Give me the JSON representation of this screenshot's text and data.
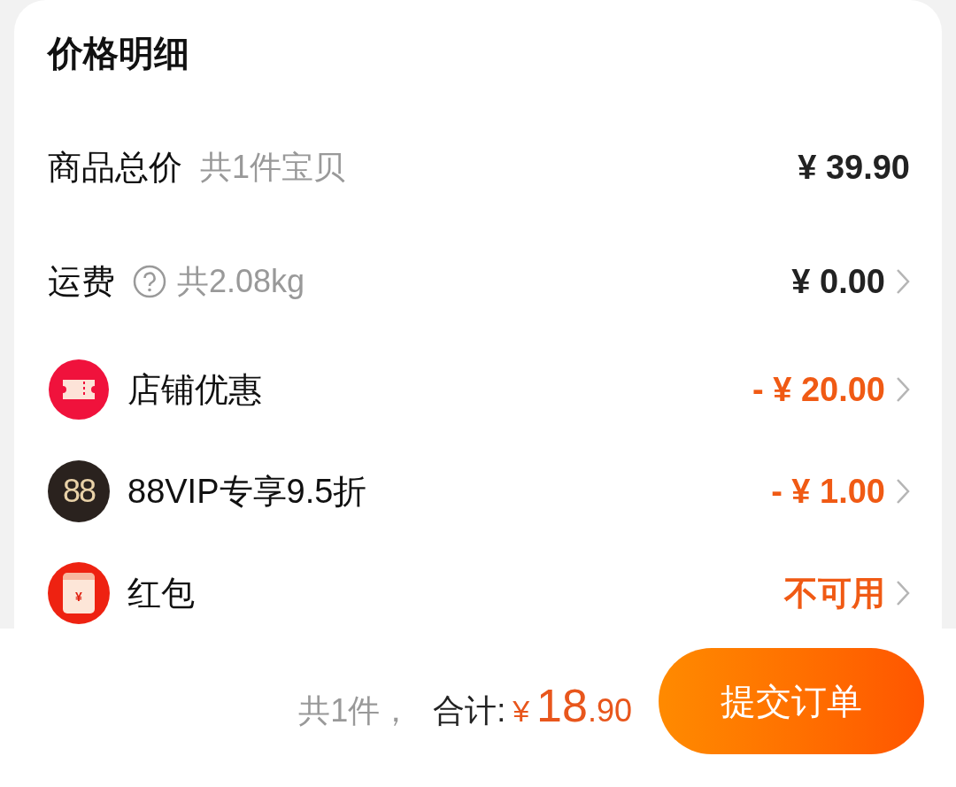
{
  "card": {
    "title": "价格明细",
    "rows": [
      {
        "kind": "plain",
        "label": "商品总价",
        "note": "共1件宝贝",
        "amount": "¥ 39.90",
        "highlight": false,
        "arrow": false
      },
      {
        "kind": "help",
        "label": "运费",
        "note": "共2.08kg",
        "amount": "¥ 0.00",
        "highlight": false,
        "arrow": true
      },
      {
        "kind": "ticket",
        "label": "店铺优惠",
        "amount": "- ¥ 20.00",
        "highlight": true,
        "arrow": true
      },
      {
        "kind": "vip",
        "icon_text": "88",
        "label": "88VIP专享9.5折",
        "amount": "- ¥ 1.00",
        "highlight": true,
        "arrow": true
      },
      {
        "kind": "envelope",
        "icon_text": "¥",
        "label": "红包",
        "amount": "不可用",
        "highlight": true,
        "arrow": true
      }
    ]
  },
  "footer": {
    "count": "共1件，",
    "total_label": "合计:",
    "currency": "¥",
    "integer": "18",
    "decimal": ".90",
    "button": "提交订单"
  }
}
